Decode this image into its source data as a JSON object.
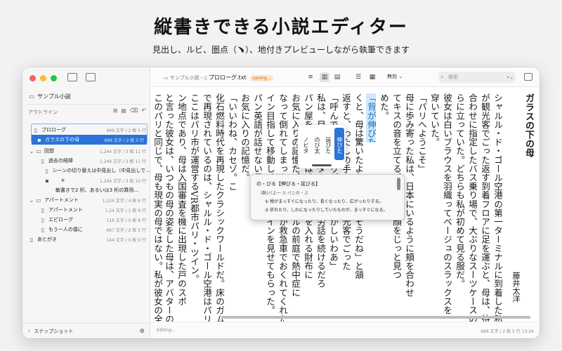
{
  "headline": "縦書きできる小説エディター",
  "subheadline": "見出し、ルビ、圏点（﹅）、地付きプレビューしながら執筆できます",
  "sidebar": {
    "project": "サンプル小説",
    "outline_label": "アウトライン",
    "items": [
      {
        "label": "プロローグ",
        "count": "699 文字 / 2 枚 5 行"
      },
      {
        "label": "ガラスの下の母",
        "count": "699 文字 / 2 枚 5 行"
      },
      {
        "label": "回想",
        "count": "1,244 文字 / 3 枚 11 行"
      },
      {
        "label": "過去の経緯",
        "count": "1,244 文字 / 3 枚 11 行"
      },
      {
        "label": "シーンの切り替えは中見出し（中見出しで…",
        "count": ""
      },
      {
        "label": "＊",
        "count": "1,244 文字 / 3 枚 10 行"
      },
      {
        "label": "敏書きで2 桁、あるいは3 桁の算用…",
        "count": ""
      },
      {
        "label": "アパートメント",
        "count": "1,224 文字 / 4 枚 6 行"
      },
      {
        "label": "アパートメント",
        "count": "1,24 文字 / 1 枚 9 行"
      },
      {
        "label": "エピローグ",
        "count": "116 文字 / 0 枚 8 行"
      },
      {
        "label": "もう一人の僕に",
        "count": "667 文字 / 2 枚 5 行"
      },
      {
        "label": "あとがき",
        "count": "144 文字 / 0 枚 9 行"
      }
    ],
    "snapshot_label": "スナップショット"
  },
  "toolbar": {
    "crumb_project": "サンプル小説 ›",
    "file": "プロローグ.txt",
    "saving": "saving...",
    "mode": "無効 ⌄",
    "search_placeholder": "検索"
  },
  "editor": {
    "title": "ガラスの下の母",
    "author": "藤井太洋",
    "columns": [
      "シャルル・ド・ゴール空港の第一ターミナルに到着した私",
      "が観光客でごった返す到着フロアに足を運ぶと、母は、待ち",
      "合わせに指定したバス乗り場で、大ぶりなスーツケースの傍",
      "らに立っていた。どちらも私が初めて見る服だ。",
      "彼女は白いブラウスを羽織ってベージュのスラックスを",
      "穿いていた。",
      "「パリへようこそ」",
      "母に歩み寄った私は、日本にいるように頬を合わせ",
      "てキスの音を立てる。母は私の顔をじっと見つ",
      "めた。",
      "「背が伸びたね」",
      "くと、母は驚いたような顔で「そうだね」と頷",
      "返すと、わたしの手を握り、観光客でごった",
      "「呼んでくれてありがとう。懐かしいわあ」",
      "私は、目を細めてタクシーの苦労話を続けるだろ",
      "パン屋を探した母は、チケットを入れる財布に",
      "お気に入りの記憶だ。ターミナルの前庭で熱中症に",
      "なって倒れてしまったのを、母が救急車でおくれてくれた",
      "イン目指して移動し、パリ・ツインを見せてもらった。",
      "パン英語が話せない母は、",
      "お気に入りの記憶だ。",
      "「いいわね、カセゾ。こ",
      "化石燃料時代を再現したクラシックワールドだ。床のガム",
      "で再現されているのは、シャルル・ド・ゴール空港はパリ",
      "ここはパリ市が運営するVR都市パリ・ツイン。",
      "ン地点であり、母は入国審査を機に出現した戸のスポ",
      "と言った彼女は、いつもの母の姿をした母は、アバターの",
      "このパリと同じで、母も現実の母ではない。私が彼女の全"
    ],
    "ruby_options": [
      "伸びた",
      "延びた",
      "のび太",
      "ノビタ"
    ],
    "dict": {
      "heading": "の・びる【伸びる・延びる】",
      "reading": "(動)バ上一 ⑦ バニの・ぶ",
      "def1": "① 物がまっすぐになったり、長くなったり、広がったりする。",
      "def2": "② 折れたり、しわになったりしていたものが、まっすぐになる。"
    }
  },
  "status": {
    "left": "Editing...",
    "right": "696 文字 / 2 枚 5 行   13:24"
  }
}
